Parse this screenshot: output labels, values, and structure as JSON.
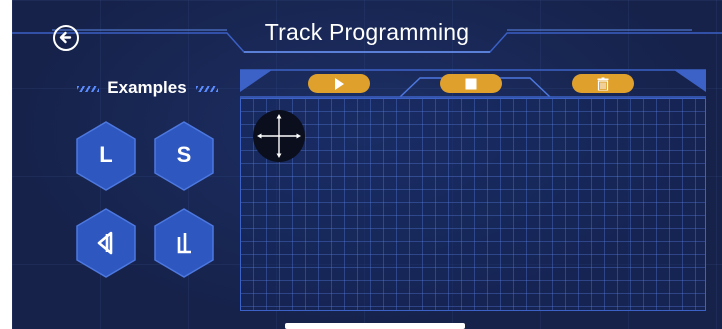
{
  "header": {
    "title": "Track Programming",
    "back_icon": "back-arrow-icon"
  },
  "examples": {
    "heading": "Examples",
    "buttons": [
      {
        "label": "L",
        "icon": null
      },
      {
        "label": "S",
        "icon": null
      },
      {
        "label": "",
        "icon": "left-turn-track-icon"
      },
      {
        "label": "",
        "icon": "right-angle-track-icon"
      }
    ]
  },
  "toolbar": {
    "buttons": [
      {
        "icon": "play-icon"
      },
      {
        "icon": "stop-icon"
      },
      {
        "icon": "trash-icon"
      }
    ]
  },
  "canvas": {
    "move_icon": "move-arrows-icon"
  },
  "colors": {
    "background": "#16224a",
    "accent_gold": "#e0a12c",
    "hex_fill": "#2e57c0",
    "frame_blue": "#3c62c8",
    "text": "#ffffff"
  }
}
